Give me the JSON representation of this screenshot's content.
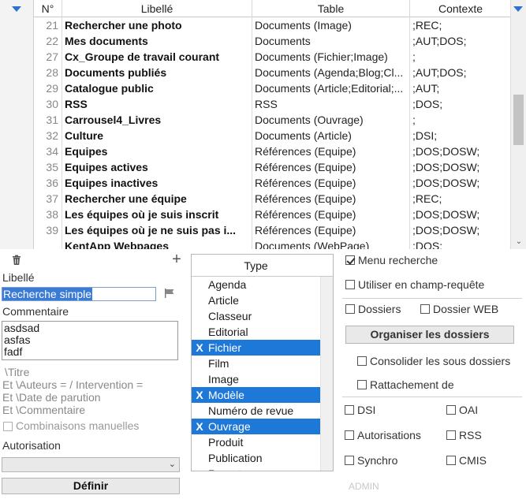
{
  "grid": {
    "columns": [
      "N°",
      "Libellé",
      "Table",
      "Contexte"
    ],
    "rows": [
      {
        "num": "21",
        "libelle": "Rechercher une photo",
        "table": "Documents (Image)",
        "contexte": ";REC;"
      },
      {
        "num": "22",
        "libelle": "Mes documents",
        "table": "Documents",
        "contexte": ";AUT;DOS;"
      },
      {
        "num": "27",
        "libelle": "Cx_Groupe de travail courant",
        "table": "Documents (Fichier;Image)",
        "contexte": ";"
      },
      {
        "num": "28",
        "libelle": "Documents publiés",
        "table": "Documents (Agenda;Blog;Cl...",
        "contexte": ";AUT;DOS;"
      },
      {
        "num": "29",
        "libelle": "Catalogue public",
        "table": "Documents (Article;Editorial;...",
        "contexte": ";AUT;"
      },
      {
        "num": "30",
        "libelle": "RSS",
        "table": "RSS",
        "contexte": ";DOS;"
      },
      {
        "num": "31",
        "libelle": "Carrousel4_Livres",
        "table": "Documents (Ouvrage)",
        "contexte": ";"
      },
      {
        "num": "32",
        "libelle": "Culture",
        "table": "Documents (Article)",
        "contexte": ";DSI;"
      },
      {
        "num": "34",
        "libelle": "Equipes",
        "table": "Références (Equipe)",
        "contexte": ";DOS;DOSW;"
      },
      {
        "num": "35",
        "libelle": "Equipes actives",
        "table": "Références (Equipe)",
        "contexte": ";DOS;DOSW;"
      },
      {
        "num": "36",
        "libelle": "Equipes inactives",
        "table": "Références (Equipe)",
        "contexte": ";DOS;DOSW;"
      },
      {
        "num": "37",
        "libelle": "Rechercher une équipe",
        "table": "Références (Equipe)",
        "contexte": ";REC;"
      },
      {
        "num": "38",
        "libelle": "Les équipes où je suis inscrit",
        "table": "Références (Equipe)",
        "contexte": ";DOS;DOSW;"
      },
      {
        "num": "39",
        "libelle": "Les équipes où je ne suis pas i...",
        "table": "Références (Equipe)",
        "contexte": ";DOS;DOSW;"
      },
      {
        "num": "",
        "libelle": "KentApp Webpages",
        "table": "Documents (WebPage)",
        "contexte": ";DOS;"
      }
    ]
  },
  "form": {
    "libelle_label": "Libellé",
    "libelle_value": "Recherche simple",
    "commentaire_label": "Commentaire",
    "commentaire_lines": [
      "asdsad",
      "asfas",
      "fadf"
    ],
    "template_lines": [
      "\\Titre",
      "Et \\Auteurs =  / Intervention =",
      "Et \\Date de parution",
      "Et \\Commentaire"
    ],
    "combinaisons_label": "Combinaisons manuelles",
    "autorisation_label": "Autorisation",
    "autorisation_value": "",
    "definir_label": "Définir"
  },
  "types": {
    "header": "Type",
    "items": [
      {
        "name": "Agenda",
        "selected": false
      },
      {
        "name": "Article",
        "selected": false
      },
      {
        "name": "Classeur",
        "selected": false
      },
      {
        "name": "Editorial",
        "selected": false
      },
      {
        "name": "Fichier",
        "selected": true
      },
      {
        "name": "Film",
        "selected": false
      },
      {
        "name": "Image",
        "selected": false
      },
      {
        "name": "Modèle",
        "selected": true
      },
      {
        "name": "Numéro de revue",
        "selected": false
      },
      {
        "name": "Ouvrage",
        "selected": true
      },
      {
        "name": "Produit",
        "selected": false
      },
      {
        "name": "Publication",
        "selected": false
      },
      {
        "name": "Reportage",
        "selected": false
      }
    ],
    "mark": "X"
  },
  "options": {
    "menu_recherche": {
      "label": "Menu recherche",
      "checked": true
    },
    "champ_requete": {
      "label": "Utiliser en champ-requête",
      "checked": false
    },
    "dossiers": {
      "label": "Dossiers",
      "checked": false
    },
    "dossier_web": {
      "label": "Dossier WEB",
      "checked": false
    },
    "organiser_label": "Organiser les dossiers",
    "consolider": {
      "label": "Consolider les sous dossiers",
      "checked": false
    },
    "rattachement": {
      "label": "Rattachement de",
      "checked": false
    },
    "dsi": {
      "label": "DSI",
      "checked": false
    },
    "oai": {
      "label": "OAI",
      "checked": false
    },
    "autorisations": {
      "label": "Autorisations",
      "checked": false
    },
    "rss": {
      "label": "RSS",
      "checked": false
    },
    "synchro": {
      "label": "Synchro",
      "checked": false
    },
    "cmis": {
      "label": "CMIS",
      "checked": false
    },
    "admin_label": "ADMIN"
  },
  "colors": {
    "accent": "#1e78d7",
    "selection": "#3a7bd5"
  }
}
